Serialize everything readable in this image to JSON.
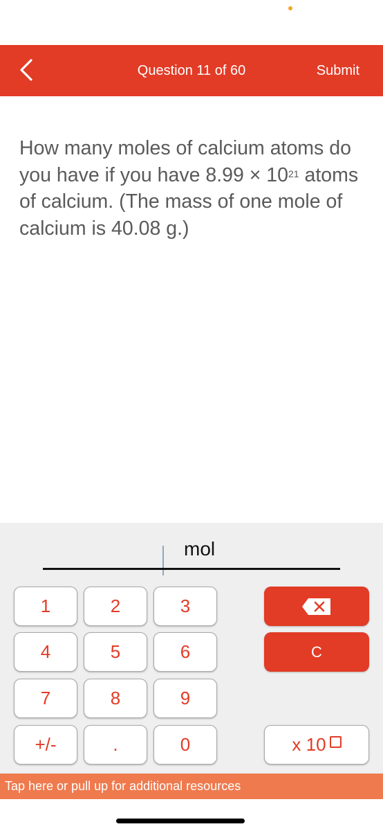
{
  "header": {
    "back_icon": "chevron-left-icon",
    "title": "Question 11 of 60",
    "submit_label": "Submit",
    "background_color": "#e23b26"
  },
  "question": {
    "text_before": "How many moles of calcium atoms do you have if you have 8.99 × 10",
    "exponent": "21",
    "text_after": " atoms of calcium. (The mass of one mole of calcium is 40.08 g.)"
  },
  "answer": {
    "value": "",
    "unit": "mol"
  },
  "keypad": {
    "keys": [
      "1",
      "2",
      "3",
      "4",
      "5",
      "6",
      "7",
      "8",
      "9",
      "+/-",
      ".",
      "0"
    ],
    "backspace_icon": "backspace-icon",
    "clear_label": "C",
    "exponent_label": "x 10",
    "accent_color": "#e23b26"
  },
  "resources_bar": {
    "label": "Tap here or pull up for additional resources",
    "color": "#ef7a4e"
  }
}
